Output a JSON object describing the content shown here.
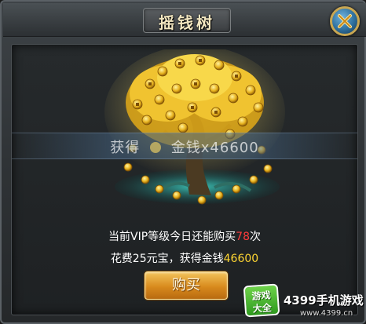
{
  "dialog": {
    "title": "摇钱树",
    "close_icon": "close-x-icon"
  },
  "scene": {
    "reward_label": "获得",
    "reward_item": "金钱",
    "reward_amount": "x46600"
  },
  "info": {
    "line1_prefix": "当前VIP等级今日还能购买",
    "remaining_count": "78",
    "line1_suffix": "次",
    "line2_prefix": "花费25元宝，获得金钱",
    "gain_amount": "46600"
  },
  "buy_button": {
    "label": "购买"
  },
  "watermark": {
    "logo_top": "游戏",
    "logo_bottom": "大全",
    "brand": "4399手机游戏",
    "url": "www.4399.cn"
  },
  "colors": {
    "highlight_red": "#ff3c3c",
    "highlight_yellow": "#ffd633",
    "button_gold": "#d88a1d"
  }
}
